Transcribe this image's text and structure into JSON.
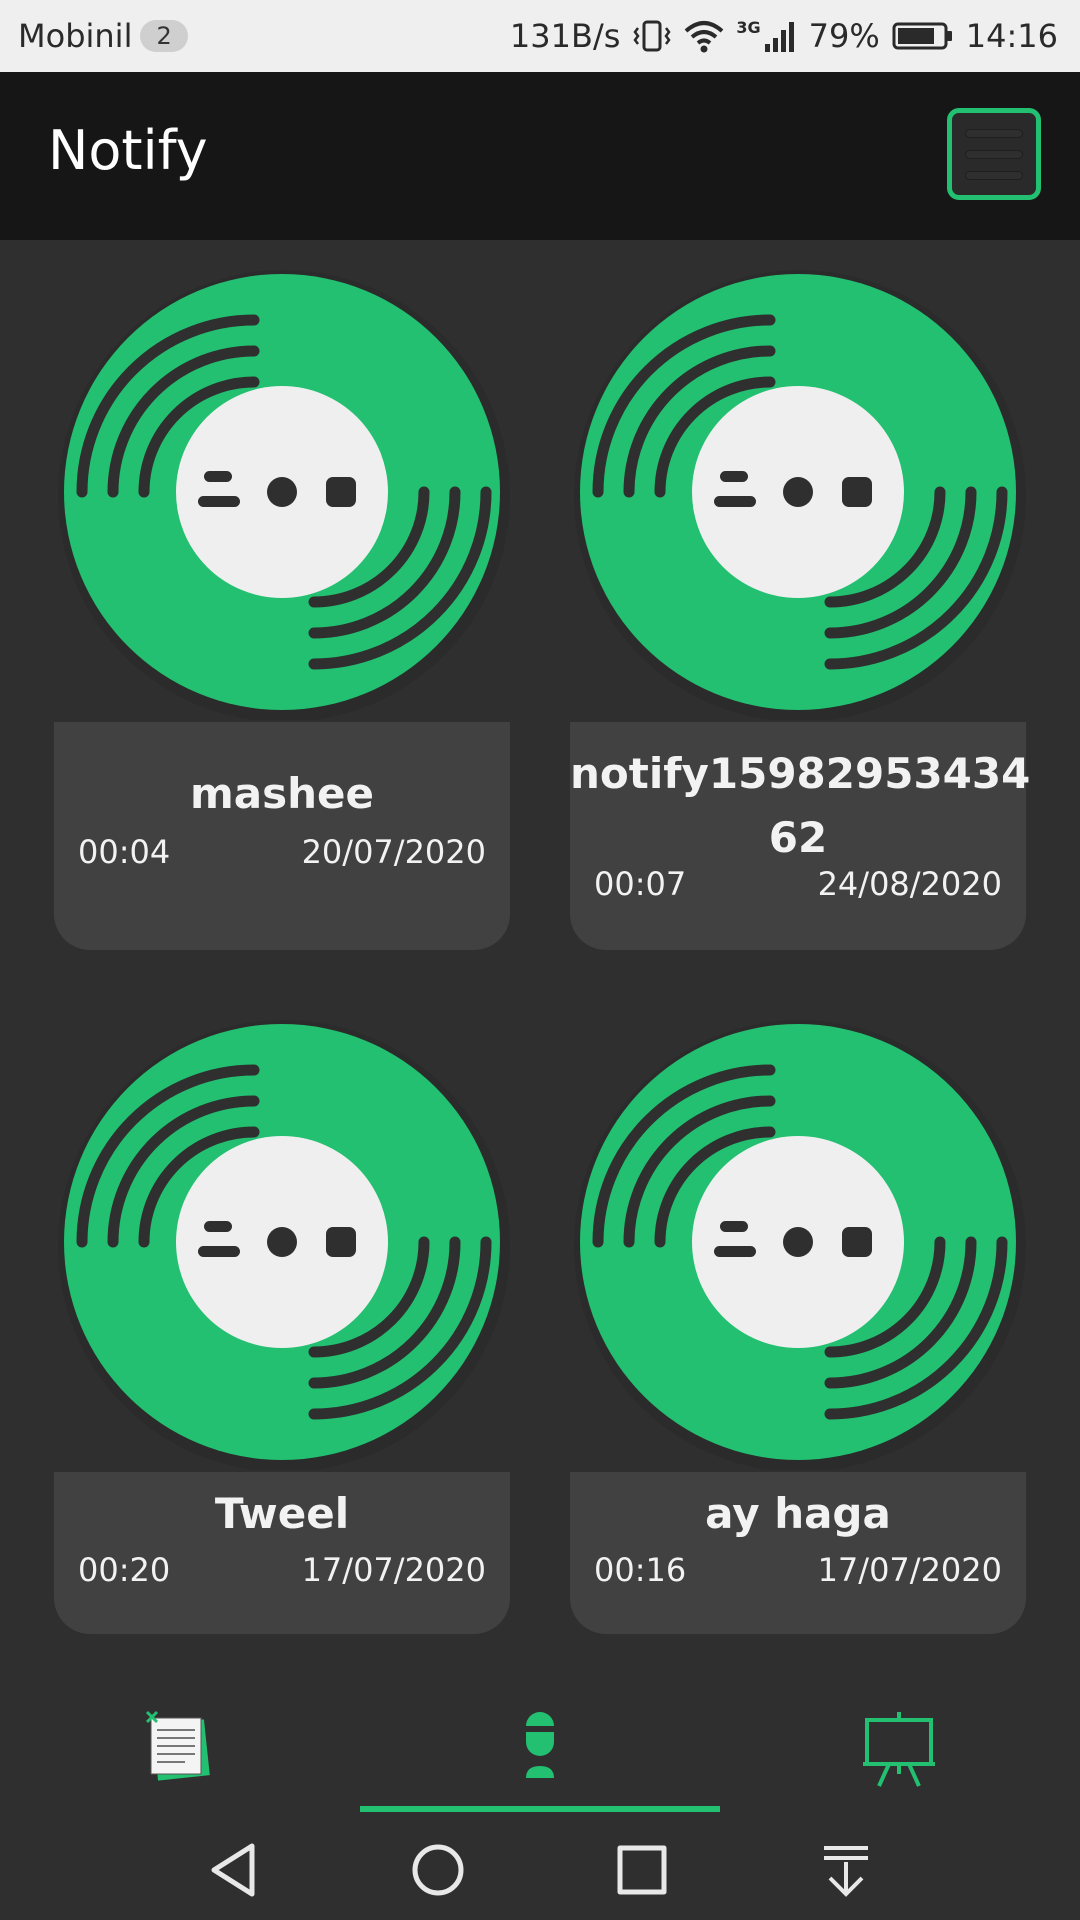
{
  "status_bar": {
    "carrier": "Mobinil",
    "sim_badge": "2",
    "net_speed": "131B/s",
    "network_type": "3G",
    "battery": "79%",
    "time": "14:16",
    "icons": [
      "vibrate-icon",
      "wifi-icon",
      "signal-icon",
      "battery-icon"
    ]
  },
  "app_bar": {
    "title": "Notify",
    "menu_icon": "hamburger-menu-icon"
  },
  "colors": {
    "accent": "#22c070",
    "background": "#2f2f2f",
    "app_bar": "#161616",
    "card": "#414141",
    "disc_center": "#efefef",
    "grooves": "#2f2f2f"
  },
  "recordings": [
    {
      "title": "mashee",
      "duration": "00:04",
      "date": "20/07/2020"
    },
    {
      "title": "notify1598295343462",
      "title_line1": "notify15982953434",
      "title_line2": "62",
      "duration": "00:07",
      "date": "24/08/2020"
    },
    {
      "title": "Tweel",
      "duration": "00:20",
      "date": "17/07/2020"
    },
    {
      "title": "ay haga",
      "duration": "00:16",
      "date": "17/07/2020"
    }
  ],
  "bottom_nav": {
    "items": [
      {
        "name": "notes",
        "icon": "notepad-icon",
        "active": false
      },
      {
        "name": "recorder",
        "icon": "microphone-icon",
        "active": true
      },
      {
        "name": "board",
        "icon": "easel-board-icon",
        "active": false
      }
    ]
  },
  "system_nav": {
    "icons": [
      "back-triangle-icon",
      "home-circle-icon",
      "recents-square-icon",
      "notifications-pulldown-icon"
    ]
  }
}
